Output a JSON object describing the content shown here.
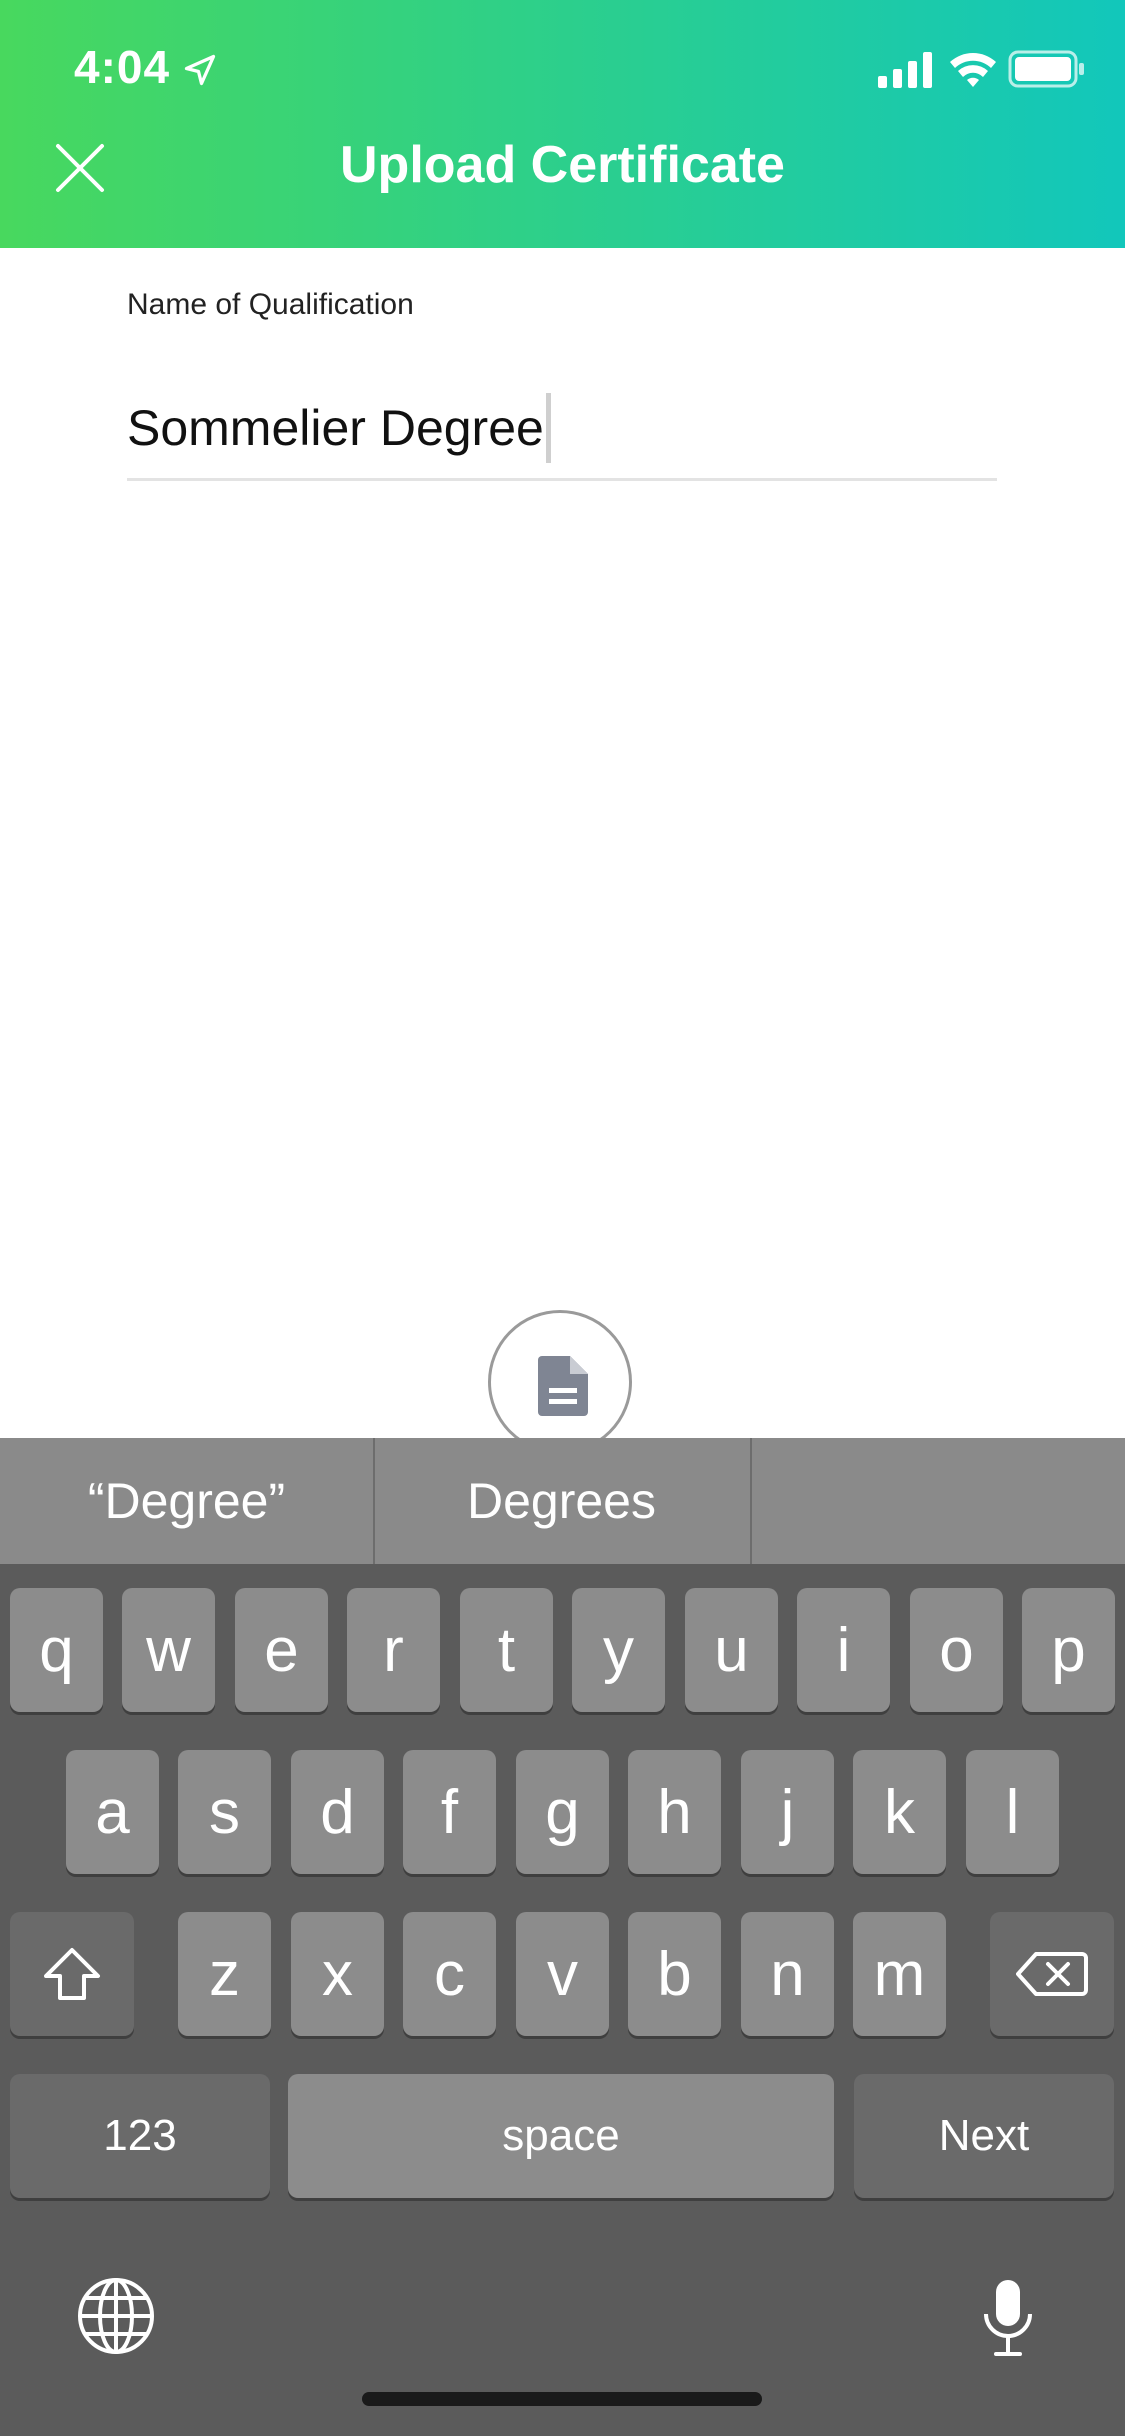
{
  "status_bar": {
    "time": "4:04",
    "icons": [
      "location-arrow-icon",
      "signal-icon",
      "wifi-icon",
      "battery-icon"
    ]
  },
  "header": {
    "title": "Upload Certificate",
    "close_icon": "close-icon",
    "gradient": [
      "#48d85e",
      "#12c7bb"
    ]
  },
  "form": {
    "label": "Name of Qualification",
    "value": "Sommelier Degree"
  },
  "upload_button": {
    "icon": "document-icon"
  },
  "keyboard": {
    "suggestions": [
      "“Degree”",
      "Degrees",
      ""
    ],
    "row1": [
      "q",
      "w",
      "e",
      "r",
      "t",
      "y",
      "u",
      "i",
      "o",
      "p"
    ],
    "row2": [
      "a",
      "s",
      "d",
      "f",
      "g",
      "h",
      "j",
      "k",
      "l"
    ],
    "row3": [
      "z",
      "x",
      "c",
      "v",
      "b",
      "n",
      "m"
    ],
    "numbers_label": "123",
    "space_label": "space",
    "next_label": "Next",
    "icons": [
      "shift-icon",
      "delete-icon",
      "globe-icon",
      "microphone-icon"
    ]
  }
}
